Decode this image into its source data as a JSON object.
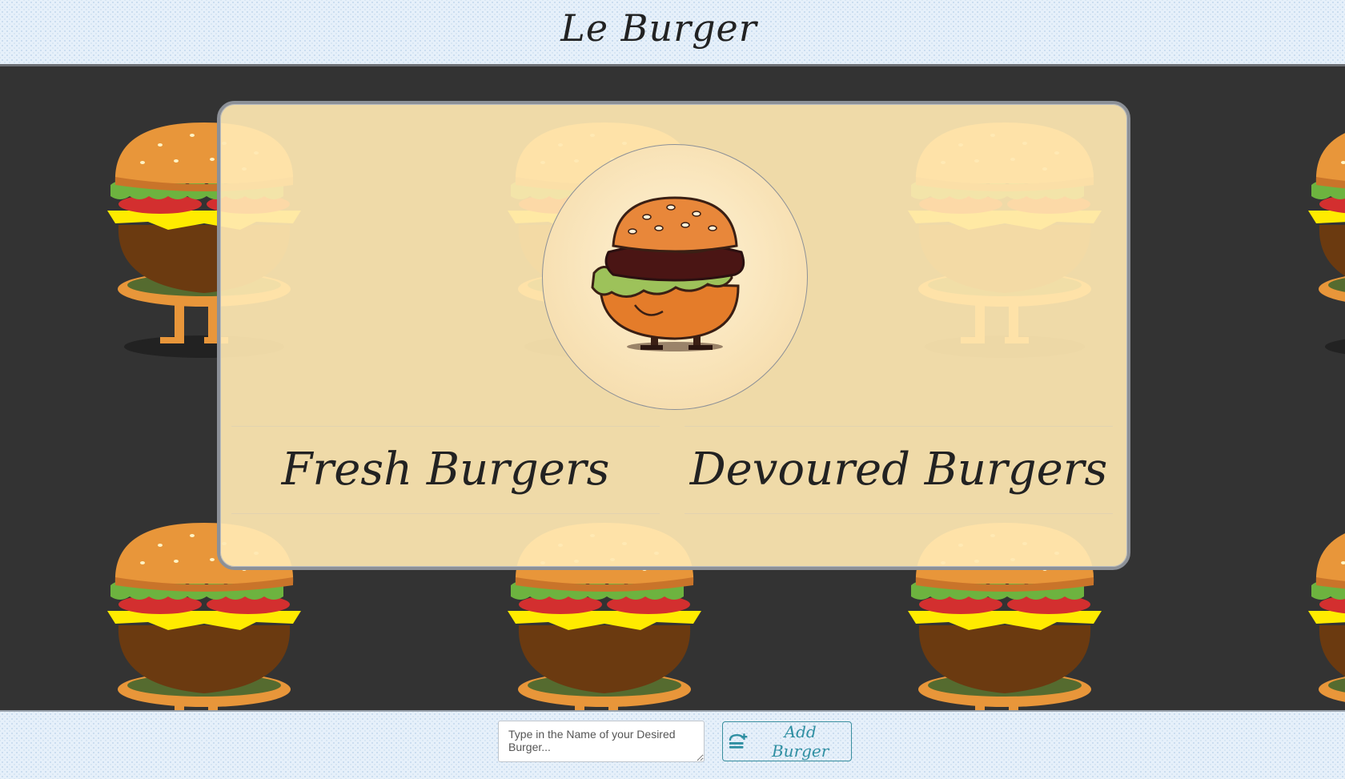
{
  "header": {
    "title": "Le Burger"
  },
  "card": {
    "logo_icon": "burger-character-icon",
    "columns": {
      "fresh_title": "Fresh Burgers",
      "devoured_title": "Devoured Burgers"
    }
  },
  "footer": {
    "input_placeholder": "Type in the Name of your Desired Burger...",
    "add_label": "Add Burger",
    "add_icon": "burger-plus-icon"
  },
  "colors": {
    "stage_bg": "#333333",
    "card_bg": "#FFE8B2",
    "accent": "#2F8FA2",
    "bun": "#E8963A",
    "lettuce": "#6DB33F",
    "tomato": "#D32F2F",
    "cheese": "#FFEB00",
    "patty": "#6B3A10"
  }
}
